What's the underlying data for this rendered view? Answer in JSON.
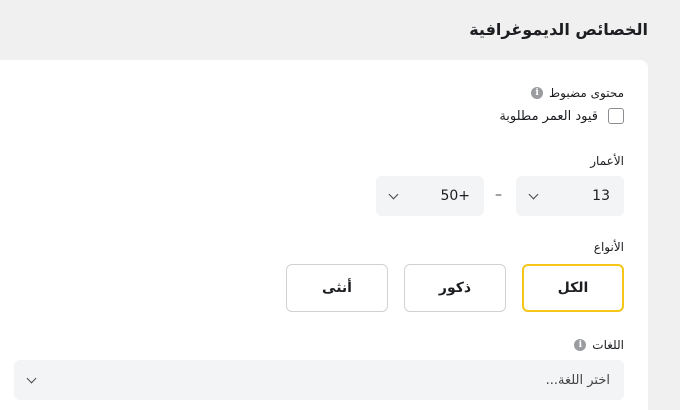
{
  "section": {
    "title": "الخصائص الديموغرافية"
  },
  "restricted": {
    "label": "محتوى مضبوط",
    "info_icon": "info-icon"
  },
  "age_checkbox": {
    "label": "قيود العمر مطلوبة",
    "checked": false
  },
  "ages": {
    "label": "الأعمار",
    "from_value": "13",
    "separator": "–",
    "to_value": "50+"
  },
  "genders": {
    "label": "الأنواع",
    "options": [
      "الكل",
      "ذكور",
      "أنثى"
    ],
    "selected": "الكل",
    "accent_color": "#f5c518"
  },
  "languages": {
    "label": "اللغات",
    "info_icon": "info-icon",
    "placeholder": "اختر اللغة..."
  }
}
